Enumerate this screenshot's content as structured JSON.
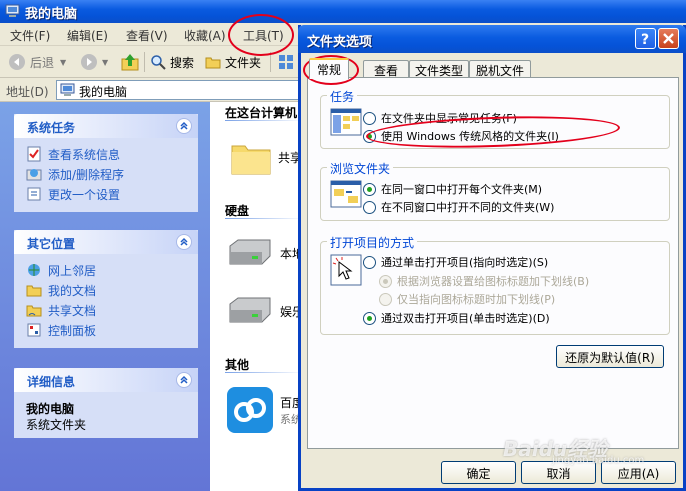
{
  "explorer": {
    "title": "我的电脑",
    "menu": [
      "文件(F)",
      "编辑(E)",
      "查看(V)",
      "收藏(A)",
      "工具(T)"
    ],
    "toolbar": {
      "back": "后退",
      "search": "搜索",
      "folders": "文件夹"
    },
    "address": {
      "label": "地址(D)",
      "value": "我的电脑"
    },
    "panels": {
      "system_tasks": {
        "title": "系统任务",
        "items": [
          "查看系统信息",
          "添加/删除程序",
          "更改一个设置"
        ]
      },
      "other_places": {
        "title": "其它位置",
        "items": [
          "网上邻居",
          "我的文档",
          "共享文档",
          "控制面板"
        ]
      },
      "details": {
        "title": "详细信息",
        "name": "我的电脑",
        "type": "系统文件夹"
      }
    },
    "content": {
      "groups": [
        "在这台计算机",
        "硬盘",
        "其他"
      ],
      "items": [
        "共享",
        "本地",
        "娱乐",
        "百度",
        "系统"
      ]
    }
  },
  "dialog": {
    "title": "文件夹选项",
    "tabs": [
      "常规",
      "查看",
      "文件类型",
      "脱机文件"
    ],
    "active_tab": "常规",
    "tasks": {
      "legend": "任务",
      "options": [
        "在文件夹中显示常见任务(F)",
        "使用 Windows 传统风格的文件夹(I)"
      ],
      "selected": 1
    },
    "browse": {
      "legend": "浏览文件夹",
      "options": [
        "在同一窗口中打开每个文件夹(M)",
        "在不同窗口中打开不同的文件夹(W)"
      ],
      "selected": 0
    },
    "open_items": {
      "legend": "打开项目的方式",
      "options": [
        "通过单击打开项目(指向时选定)(S)",
        "根据浏览器设置给图标标题加下划线(B)",
        "仅当指向图标标题时加下划线(P)",
        "通过双击打开项目(单击时选定)(D)"
      ],
      "selected": 3
    },
    "restore_defaults": "还原为默认值(R)",
    "ok": "确定",
    "cancel": "取消",
    "apply": "应用(A)"
  },
  "watermark": {
    "brand": "Baidu经验",
    "url": "jingyan.baidu.com"
  },
  "colors": {
    "xp_title_blue": "#0553d8",
    "annotation_red": "#e3001b",
    "link_blue": "#215dc6"
  }
}
